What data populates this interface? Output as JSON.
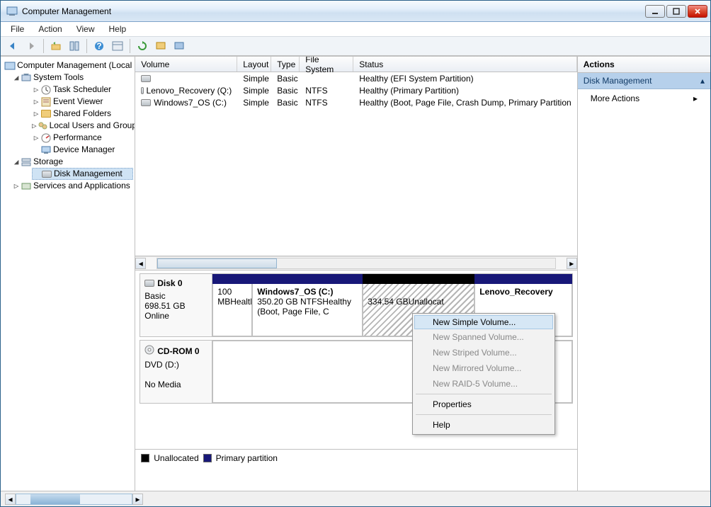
{
  "title": "Computer Management",
  "menu": {
    "file": "File",
    "action": "Action",
    "view": "View",
    "help": "Help"
  },
  "tree": {
    "root": "Computer Management (Local",
    "systemTools": "System Tools",
    "taskScheduler": "Task Scheduler",
    "eventViewer": "Event Viewer",
    "sharedFolders": "Shared Folders",
    "localUsers": "Local Users and Groups",
    "performance": "Performance",
    "deviceManager": "Device Manager",
    "storage": "Storage",
    "diskManagement": "Disk Management",
    "servicesApps": "Services and Applications"
  },
  "volHead": {
    "volume": "Volume",
    "layout": "Layout",
    "type": "Type",
    "fs": "File System",
    "status": "Status"
  },
  "volRows": [
    {
      "name": "",
      "layout": "Simple",
      "type": "Basic",
      "fs": "",
      "status": "Healthy (EFI System Partition)"
    },
    {
      "name": "Lenovo_Recovery (Q:)",
      "layout": "Simple",
      "type": "Basic",
      "fs": "NTFS",
      "status": "Healthy (Primary Partition)"
    },
    {
      "name": "Windows7_OS (C:)",
      "layout": "Simple",
      "type": "Basic",
      "fs": "NTFS",
      "status": "Healthy (Boot, Page File, Crash Dump, Primary Partition"
    }
  ],
  "disk0": {
    "name": "Disk 0",
    "type": "Basic",
    "size": "698.51 GB",
    "state": "Online",
    "p0": {
      "size": "100 MB",
      "status": "Healthy"
    },
    "p1": {
      "name": "Windows7_OS  (C:)",
      "size": "350.20 GB NTFS",
      "status": "Healthy (Boot, Page File, C"
    },
    "p2": {
      "size": "334.54 GB",
      "status": "Unallocat"
    },
    "p3": {
      "name": "Lenovo_Recovery"
    }
  },
  "cdrom": {
    "name": "CD-ROM 0",
    "sub": "DVD (D:)",
    "state": "No Media"
  },
  "legend": {
    "unalloc": "Unallocated",
    "primary": "Primary partition"
  },
  "actions": {
    "head": "Actions",
    "section": "Disk Management",
    "more": "More Actions"
  },
  "ctx": {
    "newSimple": "New Simple Volume...",
    "newSpanned": "New Spanned Volume...",
    "newStriped": "New Striped Volume...",
    "newMirrored": "New Mirrored Volume...",
    "newRaid": "New RAID-5 Volume...",
    "props": "Properties",
    "help": "Help"
  }
}
